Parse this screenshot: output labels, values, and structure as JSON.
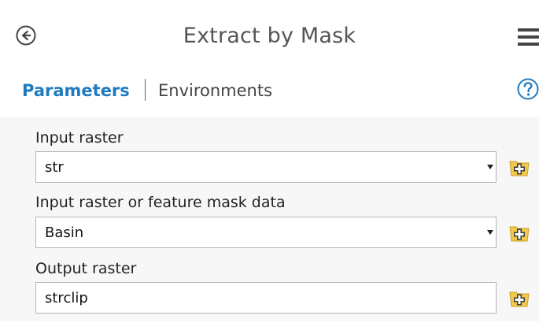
{
  "header": {
    "title": "Extract by Mask",
    "back_icon": "arrow-left-circle-icon",
    "menu_icon": "hamburger-menu-icon"
  },
  "tabs": {
    "parameters": "Parameters",
    "environments": "Environments",
    "help_icon": "question-circle-icon"
  },
  "fields": [
    {
      "label": "Input raster",
      "value": "str",
      "type": "dropdown"
    },
    {
      "label": "Input raster or feature mask data",
      "value": "Basin",
      "type": "dropdown"
    },
    {
      "label": "Output raster",
      "value": "strclip",
      "type": "text"
    }
  ],
  "colors": {
    "accent": "#1f7bc1",
    "folder": "#f2c94c",
    "title": "#555555"
  }
}
